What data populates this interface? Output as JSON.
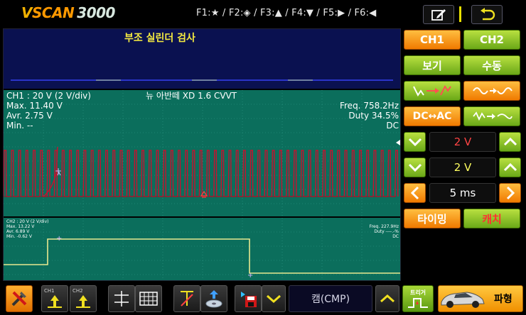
{
  "header": {
    "logo": {
      "v": "V",
      "scan": "SCAN",
      "num": "3000"
    },
    "fkeys": "F1:★ / F2:◈ / F3:▲ / F4:▼ / F5:▶ / F6:◀"
  },
  "scope": {
    "title": "부조 실린더 검사",
    "ch1": {
      "label": "CH1 : 20 V (2 V/div)",
      "vehicle": "뉴 아반떼 XD 1.6 CVVT",
      "max": "Max. 11.40 V",
      "avr": "Avr.  2.75 V",
      "min": "Min. --",
      "freq": "Freq. 758.2Hz",
      "duty": "Duty 34.5%",
      "coupling": "DC",
      "waveform_color": "#c8102e",
      "bg_color": "#0b6e5c"
    },
    "ch2": {
      "label": "CH2 : 20 V (2 V/div)",
      "max": "Max. 13.22 V",
      "avr": "Avr.  6.89 V",
      "min": "Min. -0.62 V",
      "freq": "Freq. 227.9Hz",
      "duty": "Duty ----.-%",
      "coupling": "DC",
      "waveform_color": "#e8e890"
    }
  },
  "panel": {
    "ch1": "CH1",
    "ch2": "CH2",
    "view": "보기",
    "manual": "수동",
    "dc_ac": "DC↔AC",
    "volt_ch1": "2 V",
    "volt_ch2": "2 V",
    "time": "5 ms",
    "timing": "타이밍",
    "capture": "캐치"
  },
  "toolbar": {
    "ch1_label": "CH1",
    "ch2_label": "CH2",
    "trigger_channel": "캠(CMP)",
    "trigger_label": "트리거",
    "waveform": "파형"
  },
  "colors": {
    "accent_green": "#8cc62a",
    "accent_orange": "#ff9b20",
    "trace_bg": "#0b6e5c"
  }
}
